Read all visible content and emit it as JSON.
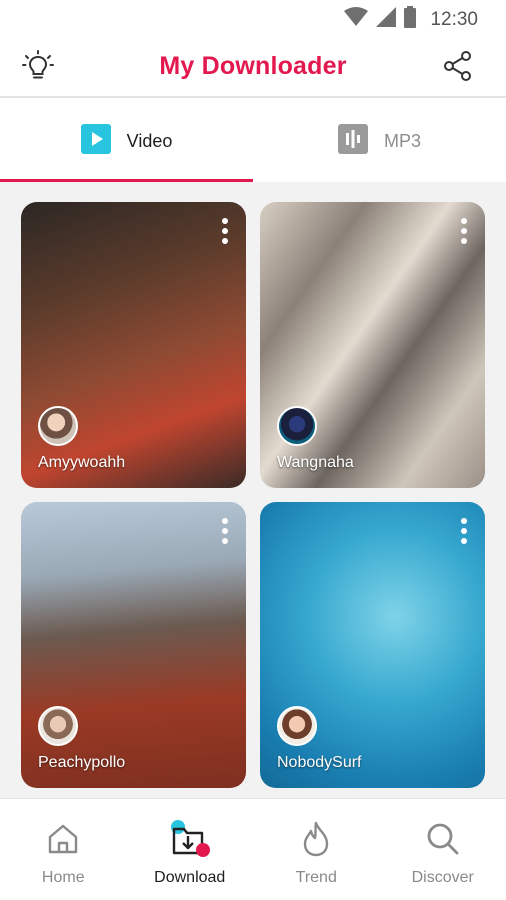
{
  "status_bar": {
    "time": "12:30",
    "icons": [
      "wifi-icon",
      "signal-icon",
      "battery-icon"
    ]
  },
  "header": {
    "title": "My Downloader",
    "left_icon": "lightbulb-icon",
    "right_icon": "share-icon"
  },
  "tabs": [
    {
      "label": "Video",
      "icon": "play-icon",
      "active": true
    },
    {
      "label": "MP3",
      "icon": "audio-bars-icon",
      "active": false
    }
  ],
  "cards": [
    {
      "username": "Amyywoahh"
    },
    {
      "username": "Wangnaha"
    },
    {
      "username": "Peachypollo"
    },
    {
      "username": "NobodySurf"
    }
  ],
  "bottom_nav": [
    {
      "label": "Home",
      "icon": "home-icon",
      "active": false
    },
    {
      "label": "Download",
      "icon": "download-folder-icon",
      "active": true
    },
    {
      "label": "Trend",
      "icon": "flame-icon",
      "active": false
    },
    {
      "label": "Discover",
      "icon": "search-icon",
      "active": false
    }
  ],
  "colors": {
    "accent": "#e3184e",
    "tab_icon_active": "#29c4e0",
    "tab_icon_inactive": "#9a9a9a",
    "background": "#f2f2f2"
  }
}
